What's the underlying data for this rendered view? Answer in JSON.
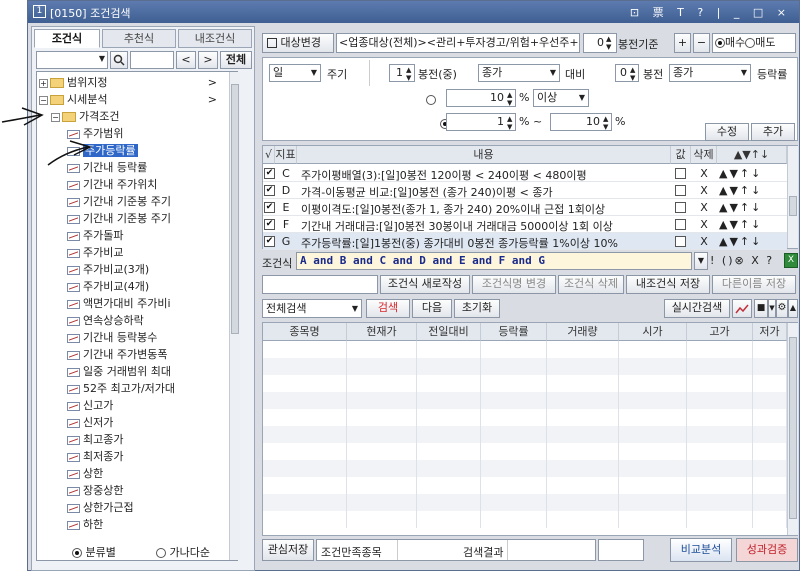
{
  "title": {
    "code": "1",
    "text": "[0150] 조건검색",
    "buttons": "⊡ 票 T ? | _ □ ×"
  },
  "left": {
    "tabs": [
      "조건식",
      "추천식",
      "내조건식"
    ],
    "search_placeholder": "",
    "nav_prev": "<",
    "nav_next": ">",
    "all_btn": "전체",
    "tree": [
      {
        "label": "범위지정",
        "kind": "folder",
        "pm": "+",
        "arrow": ">"
      },
      {
        "label": "시세분석",
        "kind": "folder",
        "pm": "−",
        "arrow": ">"
      },
      {
        "label": "가격조건",
        "kind": "folder",
        "pm": "−",
        "arrow": ""
      },
      {
        "label": "주가범위",
        "kind": "item"
      },
      {
        "label": "주가등락률",
        "kind": "item",
        "selected": true
      },
      {
        "label": "기간내 등락률",
        "kind": "item"
      },
      {
        "label": "기간내 주가위치",
        "kind": "item"
      },
      {
        "label": "기간내 기준봉 주기",
        "kind": "item"
      },
      {
        "label": "기간내 기준봉 주기",
        "kind": "item"
      },
      {
        "label": "주가돌파",
        "kind": "item"
      },
      {
        "label": "주가비교",
        "kind": "item"
      },
      {
        "label": "주가비교(3개)",
        "kind": "item"
      },
      {
        "label": "주가비교(4개)",
        "kind": "item"
      },
      {
        "label": "액면가대비 주가비i",
        "kind": "item"
      },
      {
        "label": "연속상승하락",
        "kind": "item"
      },
      {
        "label": "기간내 등락봉수",
        "kind": "item"
      },
      {
        "label": "기간내 주가변동폭",
        "kind": "item"
      },
      {
        "label": "일중 거래범위 최대",
        "kind": "item"
      },
      {
        "label": "52주 최고가/저가대",
        "kind": "item"
      },
      {
        "label": "신고가",
        "kind": "item"
      },
      {
        "label": "신저가",
        "kind": "item"
      },
      {
        "label": "최고종가",
        "kind": "item"
      },
      {
        "label": "최저종가",
        "kind": "item"
      },
      {
        "label": "상한",
        "kind": "item"
      },
      {
        "label": "장중상한",
        "kind": "item"
      },
      {
        "label": "상한가근접",
        "kind": "item"
      },
      {
        "label": "하한",
        "kind": "item"
      }
    ],
    "radio1": "분류별",
    "radio2": "가나다순"
  },
  "top": {
    "target_btn": "대상변경",
    "target_text": "<업종대상(전체)><관리+투자경고/위험+우선주+",
    "bong_value": "0",
    "bong_label": "봉전기준",
    "plus": "+",
    "minus": "−",
    "buy": "매수",
    "sell": "매도"
  },
  "cond": {
    "period": "일",
    "period_label": "주기",
    "bong1": "1",
    "bong1_label": "봉전(중)",
    "price1": "종가",
    "vs_label": "대비",
    "bong2": "0",
    "bong2_label": "봉전",
    "price2": "종가",
    "rate_label": "등락률",
    "val1": "10",
    "pct1": "%",
    "op1": "이상",
    "val2": "1",
    "pct2": "% ~",
    "val3": "10",
    "pct3": "%",
    "edit_btn": "수정",
    "add_btn": "추가"
  },
  "list": {
    "headers": [
      "√",
      "지표",
      "내용",
      "값",
      "삭제",
      "▲▼↑↓"
    ],
    "rows": [
      {
        "id": "C",
        "text": "주가이평배열(3):[일]0봉전 120이평 < 240이평 < 480이평",
        "del": "X",
        "ctl": "▲▼↑↓"
      },
      {
        "id": "D",
        "text": "가격-이동평균 비교:[일]0봉전 (종가 240)이평 < 종가",
        "del": "X",
        "ctl": "▲▼↑↓"
      },
      {
        "id": "E",
        "text": "이평이격도:[일]0봉전(종가 1, 종가 240) 20%이내 근접 1회이상",
        "del": "X",
        "ctl": "▲▼↑↓"
      },
      {
        "id": "F",
        "text": "기간내 거래대금:[일]0봉전 30봉이내 거래대금 5000이상 1회 이상",
        "del": "X",
        "ctl": "▲▼↑↓"
      },
      {
        "id": "G",
        "text": "주가등락률:[일]1봉전(중) 종가대비 0봉전 종가등락률 1%이상 10%",
        "del": "X",
        "ctl": "▲▼↑↓"
      }
    ]
  },
  "formula": {
    "label": "조건식",
    "text": "A and B and C and D and E and F and G",
    "ops": [
      "!",
      "(",
      ")",
      "⊗",
      "X",
      "?"
    ]
  },
  "actions": {
    "new": "조건식 새로작성",
    "rename": "조건식명 변경",
    "delete": "조건식 삭제",
    "save": "내조건식 저장",
    "save_as": "다른이름 저장"
  },
  "search": {
    "scope": "전체검색",
    "search_btn": "검색",
    "next_btn": "다음",
    "reset_btn": "초기화",
    "realtime_btn": "실시간검색"
  },
  "results": {
    "headers": [
      "종목명",
      "현재가",
      "전일대비",
      "등락률",
      "거래량",
      "시가",
      "고가",
      "저가"
    ]
  },
  "bottom": {
    "interest_btn": "관심저장",
    "count_label": "조건만족종목",
    "result_label": "검색결과",
    "compare_btn": "비교분석",
    "verify_btn": "성과검증"
  },
  "colors": {
    "titlebar": "#4a6aa0",
    "selected": "#2f67c8",
    "formula_bg": "#fdf6dc",
    "search_btn": "#d8262c",
    "verify_bg": "#f5d6d6"
  }
}
